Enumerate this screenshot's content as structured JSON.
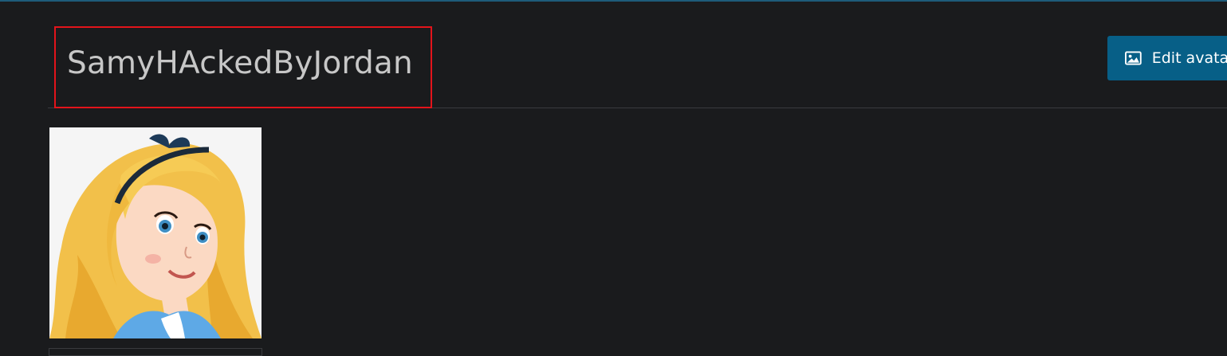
{
  "profile": {
    "username": "SamyHAckedByJordan"
  },
  "actions": {
    "edit_avatar_label": "Edit avatar",
    "edit_avatar_icon": "image-icon"
  },
  "avatar": {
    "icon": "avatar-image"
  },
  "colors": {
    "background": "#1a1b1d",
    "button": "#075f87",
    "highlight_border": "#e3141b"
  }
}
